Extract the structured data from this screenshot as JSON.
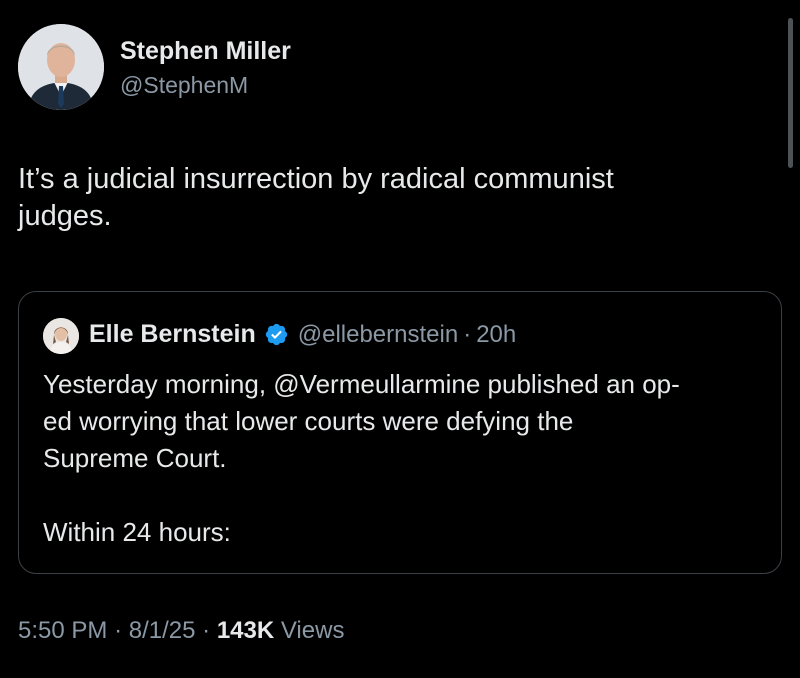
{
  "author": {
    "name": "Stephen Miller",
    "handle": "@StephenM"
  },
  "tweet": {
    "text_line1": "It’s a judicial insurrection by radical communist",
    "text_line2": "judges."
  },
  "quote": {
    "name": "Elle Bernstein",
    "handle": "@ellebernstein",
    "separator": "·",
    "time": "20h",
    "line1": "Yesterday morning, @Vermeullarmine published an op-",
    "line2": "ed worrying that lower courts were defying the",
    "line3": "Supreme Court.",
    "line4": "Within 24 hours:"
  },
  "meta": {
    "time": "5:50 PM",
    "sep1": "·",
    "date": "8/1/25",
    "sep2": "·",
    "views_count": "143K",
    "views_label": "Views"
  },
  "icons": {
    "verified": "verified-badge-icon"
  },
  "colors": {
    "background": "#000000",
    "text": "#e7e9ea",
    "secondary": "#8b98a5",
    "verified": "#1d9bf0",
    "border": "#3b4046"
  }
}
